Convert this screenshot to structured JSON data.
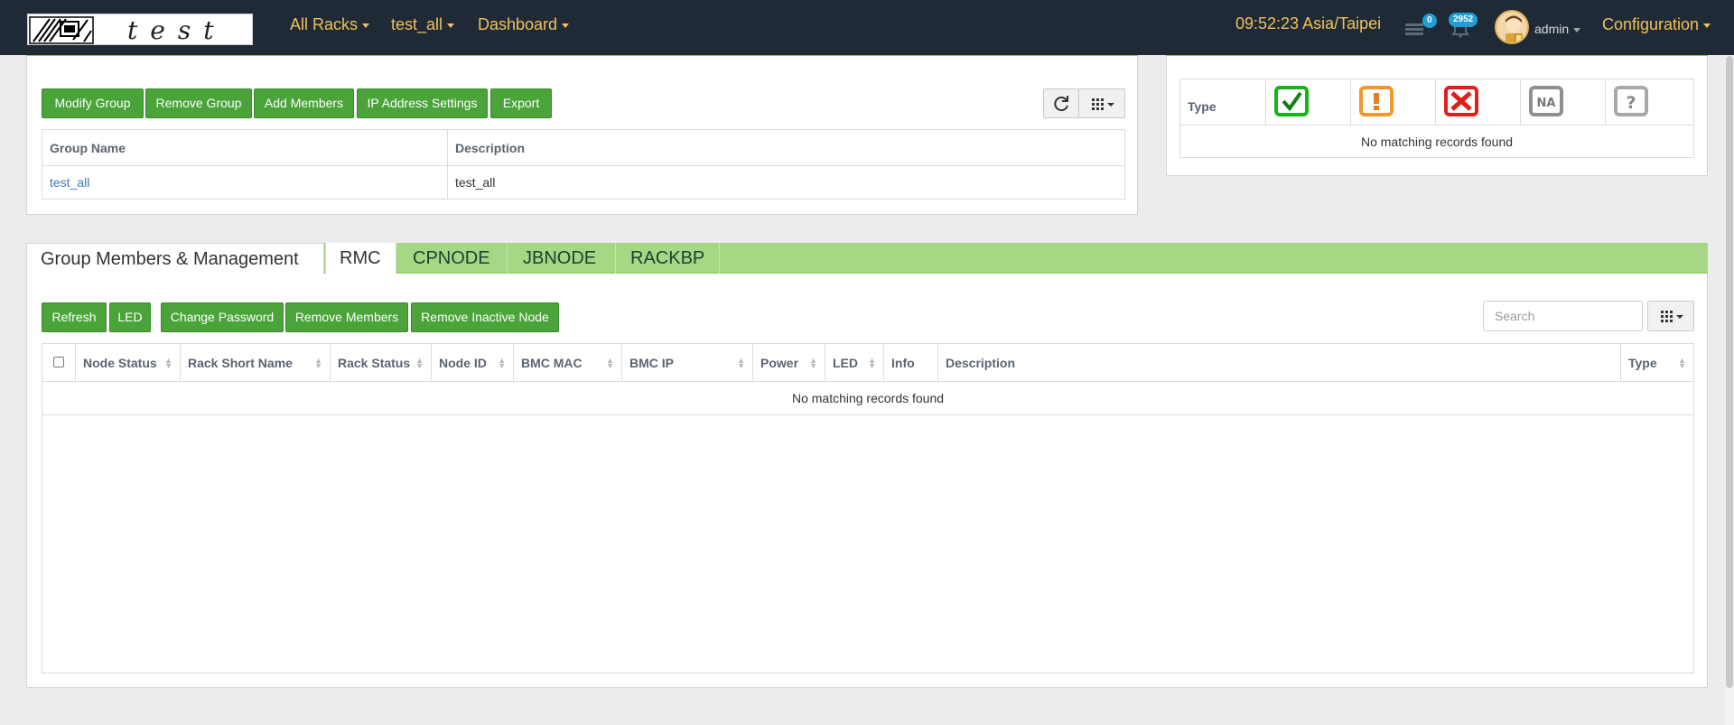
{
  "navbar": {
    "brand_text": "test",
    "menu": [
      {
        "label": "All Racks"
      },
      {
        "label": "test_all"
      },
      {
        "label": "Dashboard"
      }
    ],
    "clock": "09:52:23 Asia/Taipei",
    "list_badge": "0",
    "bell_badge": "2952",
    "user": "admin",
    "configuration": "Configuration"
  },
  "group_panel": {
    "buttons": {
      "modify": "Modify Group",
      "remove": "Remove Group",
      "add_members": "Add Members",
      "ip_settings": "IP Address Settings",
      "export": "Export"
    },
    "columns": {
      "name": "Group Name",
      "description": "Description"
    },
    "rows": [
      {
        "name": "test_all",
        "description": "test_all"
      }
    ]
  },
  "status_panel": {
    "type_label": "Type",
    "icons": [
      "ok-icon",
      "warning-icon",
      "critical-icon",
      "na-icon",
      "unknown-icon"
    ],
    "na_text": "NA",
    "unknown_text": "?",
    "empty": "No matching records found"
  },
  "tabs": [
    {
      "label": "Group Members & Management"
    },
    {
      "label": "RMC"
    },
    {
      "label": "CPNODE"
    },
    {
      "label": "JBNODE"
    },
    {
      "label": "RACKBP"
    }
  ],
  "members_panel": {
    "buttons": {
      "refresh": "Refresh",
      "led": "LED",
      "change_password": "Change Password",
      "remove_members": "Remove Members",
      "remove_inactive": "Remove Inactive Node"
    },
    "search_placeholder": "Search",
    "columns": {
      "node_status": "Node Status",
      "rack_short_name": "Rack Short Name",
      "rack_status": "Rack Status",
      "node_id": "Node ID",
      "bmc_mac": "BMC MAC",
      "bmc_ip": "BMC IP",
      "power": "Power",
      "led": "LED",
      "info": "Info",
      "description": "Description",
      "type": "Type"
    },
    "empty": "No matching records found"
  },
  "colors": {
    "navbar_bg": "#1f2a36",
    "nav_text": "#f0c15a",
    "button_green": "#4aa43a",
    "tab_green": "#a6d785",
    "badge_blue": "#1e9fd6"
  }
}
